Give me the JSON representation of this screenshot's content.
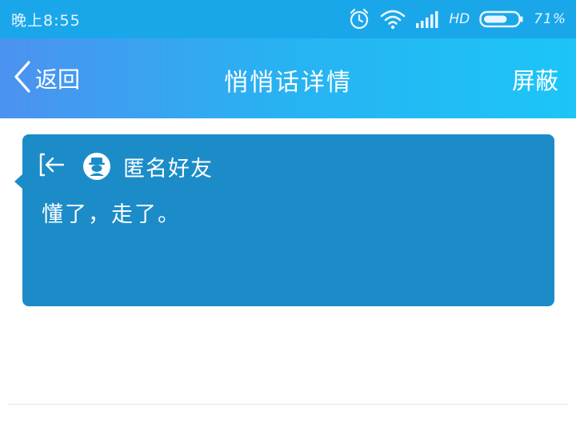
{
  "status_bar": {
    "time": "晚上8:55",
    "network": "HD",
    "battery_percent": "71%",
    "battery_level": 0.71,
    "icons": [
      "alarm-icon",
      "wifi-icon",
      "signal-icon",
      "battery-icon"
    ]
  },
  "nav": {
    "back_label": "返回",
    "title": "悄悄话详情",
    "block_label": "屏蔽",
    "back_icon": "chevron-left-icon"
  },
  "message": {
    "sender_name": "匿名好友",
    "text": "懂了，走了。",
    "incoming_icon": "incoming-arrow-icon",
    "avatar_icon": "anonymous-avatar-icon"
  },
  "colors": {
    "status_bar": "#1aa7ea",
    "nav_gradient_start": "#4c92f0",
    "nav_gradient_end": "#1cc5f6",
    "bubble": "#1b8cc8"
  }
}
